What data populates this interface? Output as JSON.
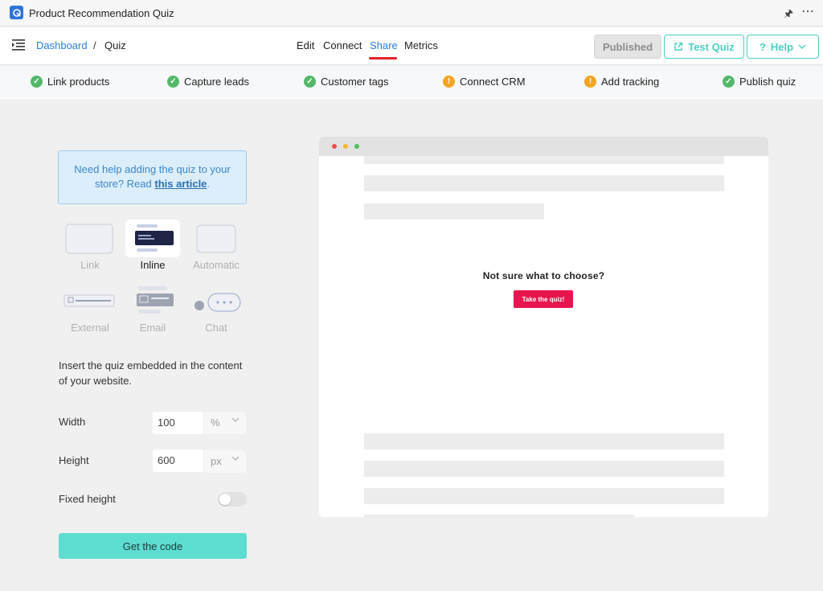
{
  "window": {
    "title": "Product Recommendation Quiz"
  },
  "breadcrumb": {
    "root": "Dashboard",
    "separator": "/",
    "current": "Quiz"
  },
  "nav": {
    "tabs": [
      {
        "label": "Edit"
      },
      {
        "label": "Connect"
      },
      {
        "label": "Share",
        "active": true
      },
      {
        "label": "Metrics"
      }
    ]
  },
  "actions": {
    "published": "Published",
    "test_quiz": "Test Quiz",
    "help": "Help"
  },
  "checklist": [
    {
      "label": "Link products",
      "status": "done"
    },
    {
      "label": "Capture leads",
      "status": "done"
    },
    {
      "label": "Customer tags",
      "status": "done"
    },
    {
      "label": "Connect CRM",
      "status": "warning"
    },
    {
      "label": "Add tracking",
      "status": "warning"
    },
    {
      "label": "Publish quiz",
      "status": "done"
    }
  ],
  "help_box": {
    "text": "Need help adding the quiz to your store? Read",
    "link": "this article",
    "suffix": "."
  },
  "embed_types": [
    {
      "label": "Link",
      "selected": false
    },
    {
      "label": "Inline",
      "selected": true
    },
    {
      "label": "Automatic",
      "selected": false
    },
    {
      "label": "External",
      "selected": false
    },
    {
      "label": "Email",
      "selected": false
    },
    {
      "label": "Chat",
      "selected": false
    }
  ],
  "description": "Insert the quiz embedded in the content of your website.",
  "fields": {
    "width": {
      "label": "Width",
      "value": "100",
      "unit": "%"
    },
    "height": {
      "label": "Height",
      "value": "600",
      "unit": "px"
    },
    "fixed_height": {
      "label": "Fixed height",
      "enabled": false
    }
  },
  "get_code": "Get the code",
  "preview": {
    "question": "Not sure what to choose?",
    "button": "Take the quiz!"
  },
  "colors": {
    "accent": "#2b7de0",
    "teal": "#48cfc0",
    "done": "#54b86a",
    "warning": "#f4a521",
    "quiz_button": "#e8154f"
  }
}
